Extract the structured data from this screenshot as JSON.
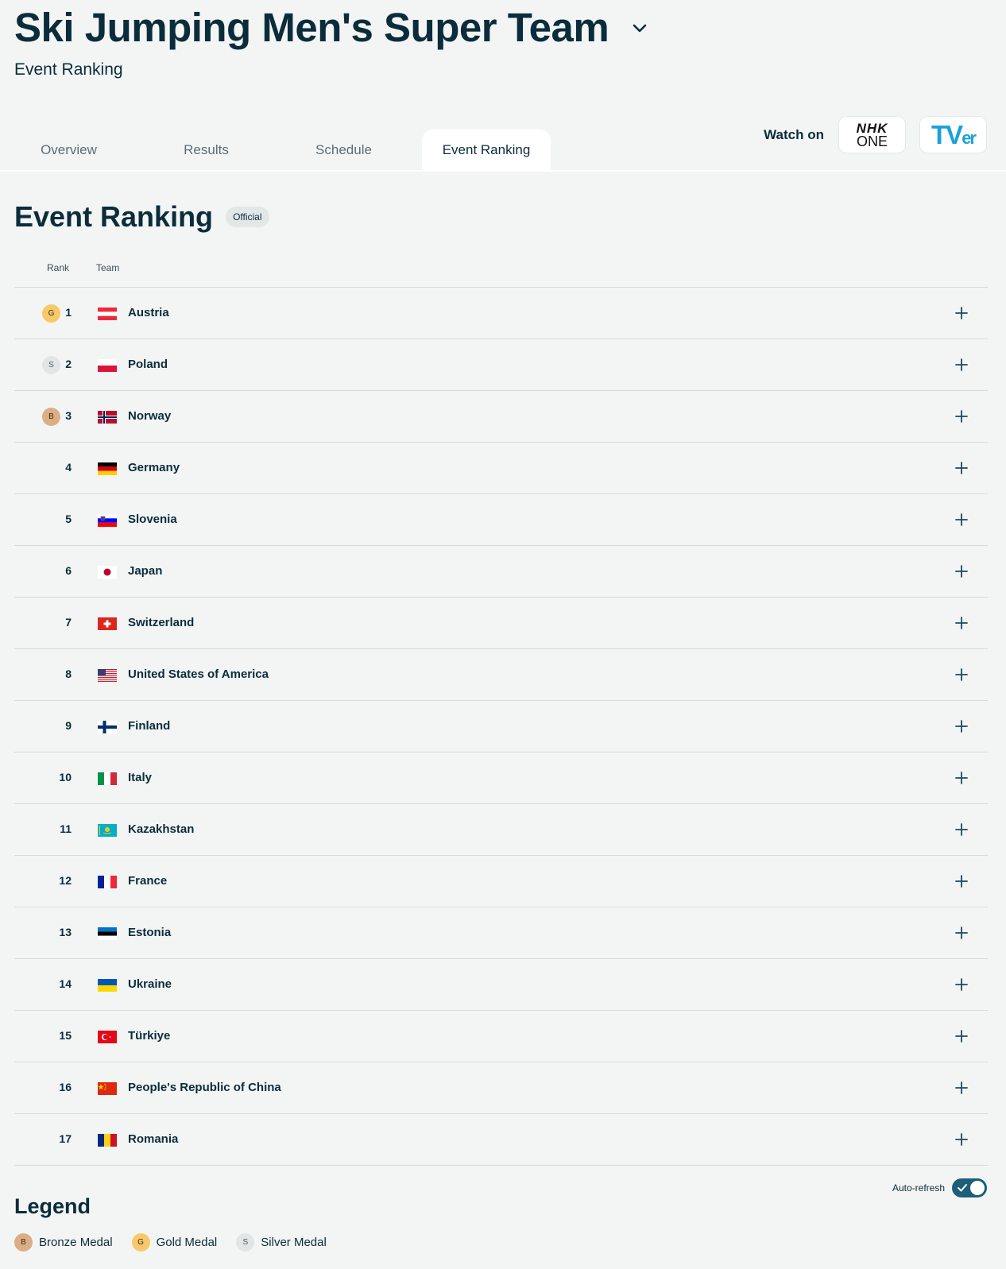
{
  "header": {
    "title": "Ski Jumping Men's Super Team",
    "subtitle": "Event Ranking"
  },
  "tabs": [
    {
      "label": "Overview",
      "active": false
    },
    {
      "label": "Results",
      "active": false
    },
    {
      "label": "Schedule",
      "active": false
    },
    {
      "label": "Event Ranking",
      "active": true
    }
  ],
  "watch": {
    "label": "Watch on",
    "nhk_line1": "NHK",
    "nhk_line2": "ONE",
    "tver_main": "TV",
    "tver_small": "er"
  },
  "section": {
    "title": "Event Ranking",
    "badge": "Official"
  },
  "columns": {
    "rank": "Rank",
    "team": "Team"
  },
  "rows": [
    {
      "rank": "1",
      "medal": "G",
      "medal_type": "gold",
      "team": "Austria",
      "flag": "austria"
    },
    {
      "rank": "2",
      "medal": "S",
      "medal_type": "silver",
      "team": "Poland",
      "flag": "poland"
    },
    {
      "rank": "3",
      "medal": "B",
      "medal_type": "bronze",
      "team": "Norway",
      "flag": "norway"
    },
    {
      "rank": "4",
      "medal": "",
      "medal_type": "",
      "team": "Germany",
      "flag": "germany"
    },
    {
      "rank": "5",
      "medal": "",
      "medal_type": "",
      "team": "Slovenia",
      "flag": "slovenia"
    },
    {
      "rank": "6",
      "medal": "",
      "medal_type": "",
      "team": "Japan",
      "flag": "japan"
    },
    {
      "rank": "7",
      "medal": "",
      "medal_type": "",
      "team": "Switzerland",
      "flag": "switzerland"
    },
    {
      "rank": "8",
      "medal": "",
      "medal_type": "",
      "team": "United States of America",
      "flag": "usa"
    },
    {
      "rank": "9",
      "medal": "",
      "medal_type": "",
      "team": "Finland",
      "flag": "finland"
    },
    {
      "rank": "10",
      "medal": "",
      "medal_type": "",
      "team": "Italy",
      "flag": "italy"
    },
    {
      "rank": "11",
      "medal": "",
      "medal_type": "",
      "team": "Kazakhstan",
      "flag": "kazakhstan"
    },
    {
      "rank": "12",
      "medal": "",
      "medal_type": "",
      "team": "France",
      "flag": "france"
    },
    {
      "rank": "13",
      "medal": "",
      "medal_type": "",
      "team": "Estonia",
      "flag": "estonia"
    },
    {
      "rank": "14",
      "medal": "",
      "medal_type": "",
      "team": "Ukraine",
      "flag": "ukraine"
    },
    {
      "rank": "15",
      "medal": "",
      "medal_type": "",
      "team": "Türkiye",
      "flag": "turkiye"
    },
    {
      "rank": "16",
      "medal": "",
      "medal_type": "",
      "team": "People's Republic of China",
      "flag": "china"
    },
    {
      "rank": "17",
      "medal": "",
      "medal_type": "",
      "team": "Romania",
      "flag": "romania"
    }
  ],
  "auto_refresh": {
    "label": "Auto-refresh",
    "enabled": true
  },
  "legend": {
    "title": "Legend",
    "items": [
      {
        "letter": "B",
        "type": "bronze",
        "label": "Bronze Medal"
      },
      {
        "letter": "G",
        "type": "gold",
        "label": "Gold Medal"
      },
      {
        "letter": "S",
        "type": "silver",
        "label": "Silver Medal"
      }
    ]
  },
  "colors": {
    "primary": "#0b2c3b",
    "background": "#f3f5f4",
    "gold": "#f8c96a",
    "silver": "#e1e5e6",
    "bronze": "#dcae85",
    "toggle": "#1b5f7a"
  }
}
